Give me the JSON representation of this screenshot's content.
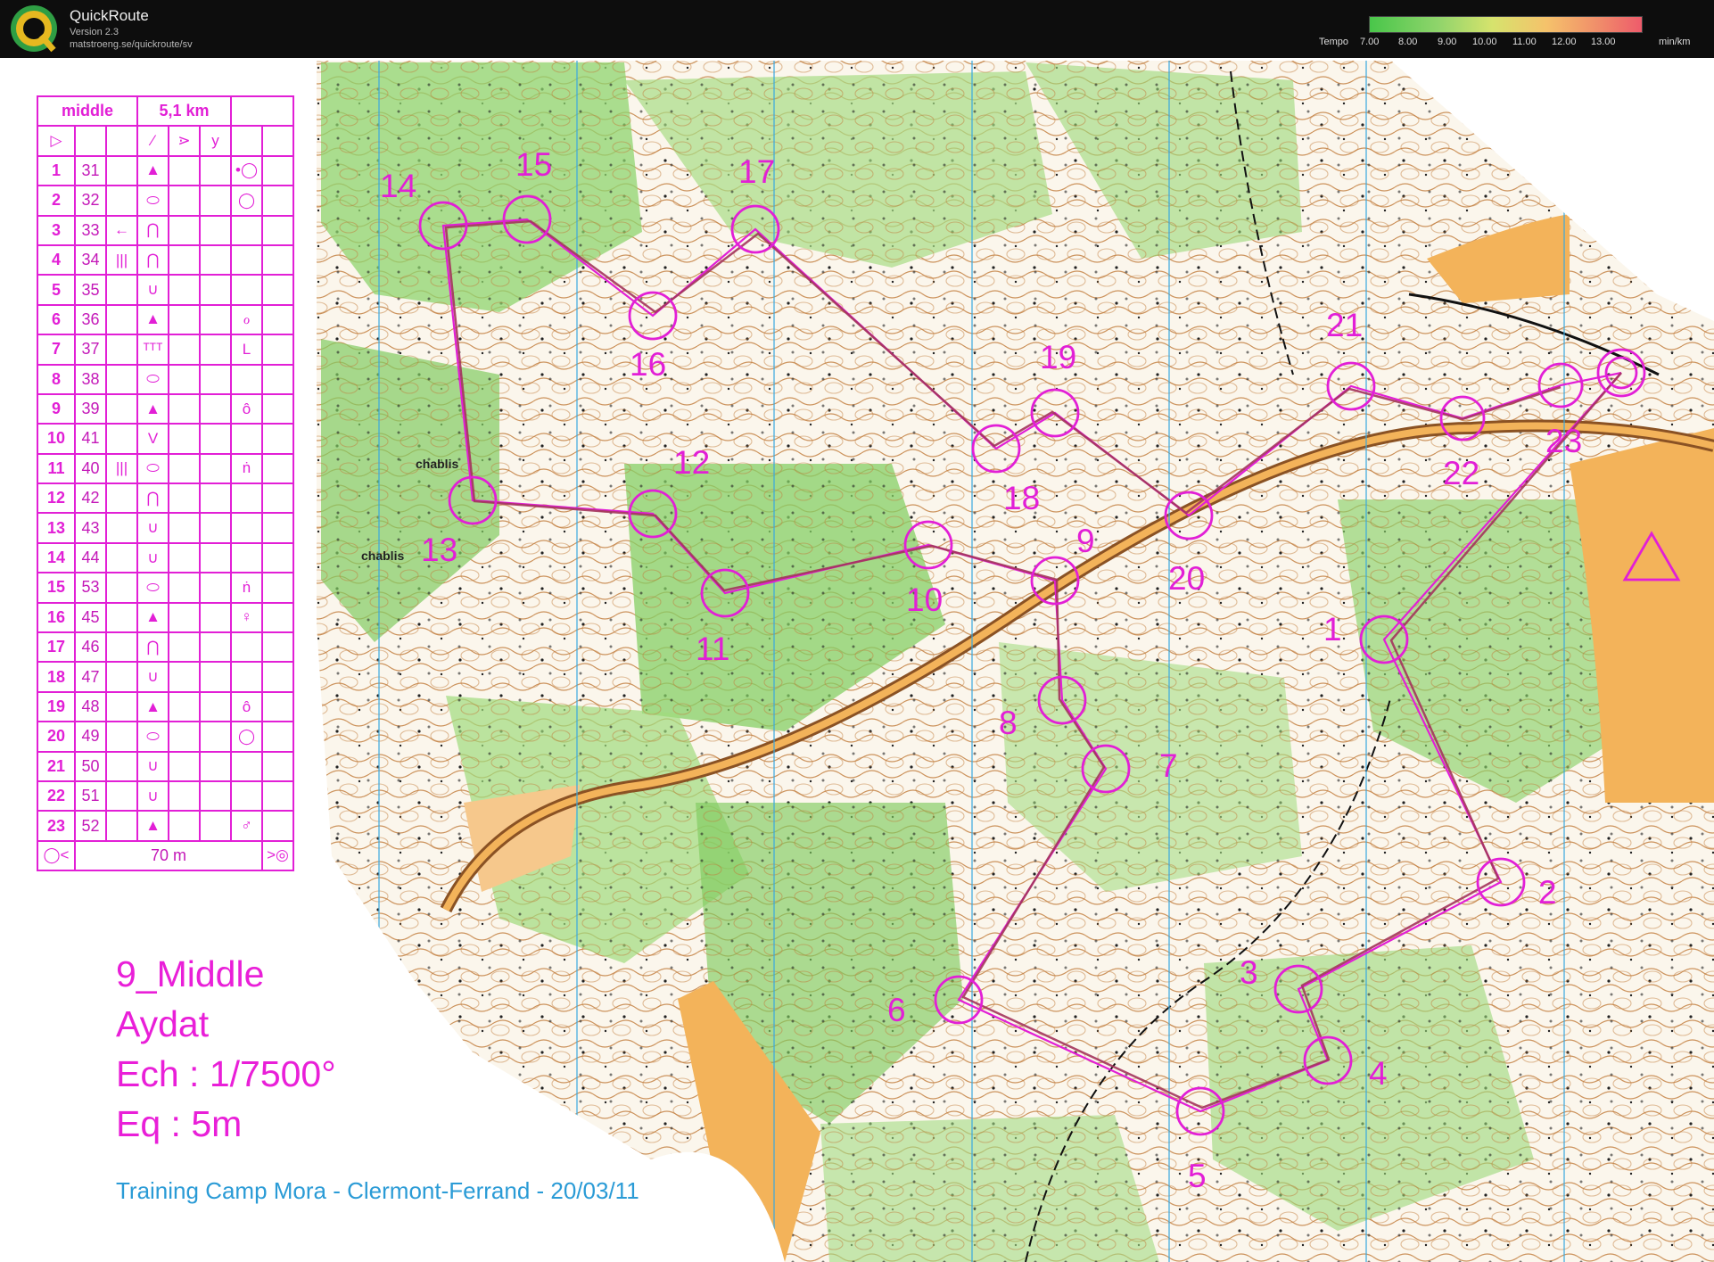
{
  "app": {
    "name": "QuickRoute",
    "version": "Version 2.3",
    "url": "matstroeng.se/quickroute/sv"
  },
  "tempo": {
    "label": "Tempo",
    "ticks": [
      "7.00",
      "8.00",
      "9.00",
      "10.00",
      "11.00",
      "12.00",
      "13.00"
    ],
    "unit": "min/km"
  },
  "course": {
    "header_name": "middle",
    "header_length": "5,1 km",
    "final_distance": "70 m",
    "controls": [
      {
        "n": "1",
        "code": "31",
        "feature": "▲",
        "cols": "",
        "extra": "•◯"
      },
      {
        "n": "2",
        "code": "32",
        "feature": "⬭",
        "cols": "",
        "extra": "◯"
      },
      {
        "n": "3",
        "code": "33",
        "feature": "⋂",
        "cols": "←",
        "extra": ""
      },
      {
        "n": "4",
        "code": "34",
        "feature": "⋂",
        "cols": "|||",
        "extra": ""
      },
      {
        "n": "5",
        "code": "35",
        "feature": "∪",
        "cols": "",
        "extra": ""
      },
      {
        "n": "6",
        "code": "36",
        "feature": "▲",
        "cols": "",
        "extra": "ℴ"
      },
      {
        "n": "7",
        "code": "37",
        "feature": "ᵀᵀᵀ",
        "cols": "",
        "extra": "L"
      },
      {
        "n": "8",
        "code": "38",
        "feature": "⬭",
        "cols": "",
        "extra": ""
      },
      {
        "n": "9",
        "code": "39",
        "feature": "▲",
        "cols": "",
        "extra": "ô"
      },
      {
        "n": "10",
        "code": "41",
        "feature": "V",
        "cols": "",
        "extra": ""
      },
      {
        "n": "11",
        "code": "40",
        "feature": "⬭",
        "cols": "|||",
        "extra": "ṅ"
      },
      {
        "n": "12",
        "code": "42",
        "feature": "⋂",
        "cols": "",
        "extra": ""
      },
      {
        "n": "13",
        "code": "43",
        "feature": "∪",
        "cols": "",
        "extra": ""
      },
      {
        "n": "14",
        "code": "44",
        "feature": "∪",
        "cols": "",
        "extra": ""
      },
      {
        "n": "15",
        "code": "53",
        "feature": "⬭",
        "cols": "",
        "extra": "ṅ"
      },
      {
        "n": "16",
        "code": "45",
        "feature": "▲",
        "cols": "",
        "extra": "♀"
      },
      {
        "n": "17",
        "code": "46",
        "feature": "⋂",
        "cols": "",
        "extra": ""
      },
      {
        "n": "18",
        "code": "47",
        "feature": "∪",
        "cols": "",
        "extra": ""
      },
      {
        "n": "19",
        "code": "48",
        "feature": "▲",
        "cols": "",
        "extra": "ô"
      },
      {
        "n": "20",
        "code": "49",
        "feature": "⬭",
        "cols": "",
        "extra": "◯"
      },
      {
        "n": "21",
        "code": "50",
        "feature": "∪",
        "cols": "",
        "extra": ""
      },
      {
        "n": "22",
        "code": "51",
        "feature": "∪",
        "cols": "",
        "extra": ""
      },
      {
        "n": "23",
        "code": "52",
        "feature": "▲",
        "cols": "",
        "extra": "♂"
      }
    ]
  },
  "map_info": {
    "line1": "9_Middle",
    "line2": "Aydat",
    "line3": "Ech : 1/7500°",
    "line4": "Eq : 5m",
    "footer": "Training Camp Mora - Clermont-Ferrand - 20/03/11"
  },
  "places": {
    "p1": "chablis",
    "p2": "chablis"
  },
  "colors": {
    "overprint": "#e21fd6",
    "route": "#b0306a",
    "open_land": "#f7a53d",
    "forest": "#79cf5b",
    "contour": "#b86a2a"
  },
  "control_labels": [
    "1",
    "2",
    "3",
    "4",
    "5",
    "6",
    "7",
    "8",
    "9",
    "10",
    "11",
    "12",
    "13",
    "14",
    "15",
    "16",
    "17",
    "18",
    "19",
    "20",
    "21",
    "22",
    "23"
  ]
}
